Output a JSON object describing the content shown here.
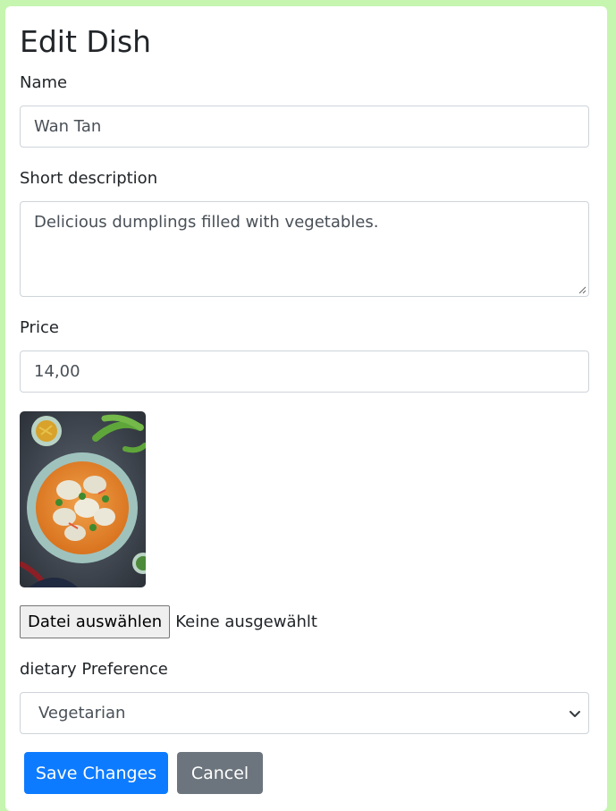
{
  "page": {
    "title": "Edit Dish"
  },
  "form": {
    "name_label": "Name",
    "name_value": "Wan Tan",
    "description_label": "Short description",
    "description_value": "Delicious dumplings filled with vegetables.",
    "price_label": "Price",
    "price_value": "14,00",
    "image_alt": "dish-photo",
    "file_button_label": "Datei auswählen",
    "file_status": "Keine ausgewählt",
    "diet_label": "dietary Preference",
    "diet_selected": "Vegetarian",
    "save_label": "Save Changes",
    "cancel_label": "Cancel"
  },
  "colors": {
    "page_background": "#c6f5b0",
    "primary": "#0d7bff",
    "secondary": "#6c757d"
  }
}
